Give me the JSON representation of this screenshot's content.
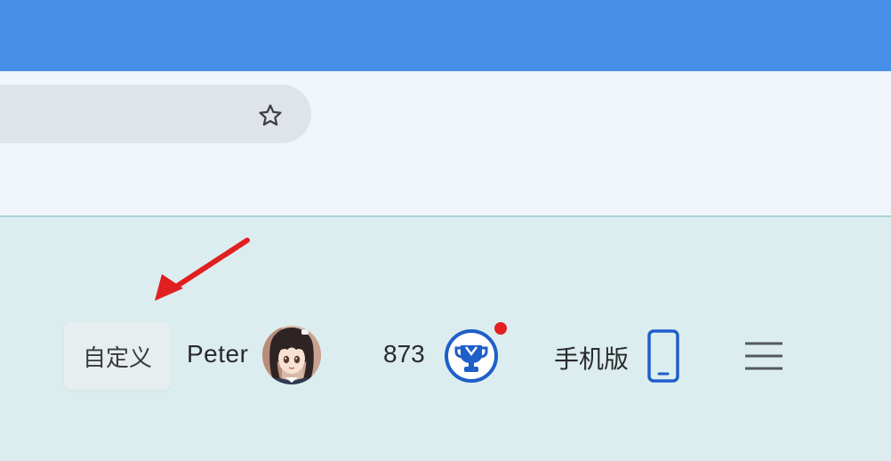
{
  "icons": {
    "bookmark_star": "star-outline-icon",
    "avatar": "anime-girl-avatar",
    "trophy": "trophy-badge-icon",
    "phone": "mobile-phone-icon",
    "menu": "hamburger-menu-icon",
    "arrow": "red-pointer-arrow"
  },
  "colors": {
    "titlebar": "#4590e6",
    "toolbar": "#f1f6fd",
    "content": "#dcedf0",
    "accent": "#1e5fc8",
    "notification": "#e41f1f",
    "annotation_arrow": "#e02020"
  },
  "user_bar": {
    "customize_label": "自定义",
    "username": "Peter",
    "score": "873",
    "mobile_label": "手机版"
  }
}
